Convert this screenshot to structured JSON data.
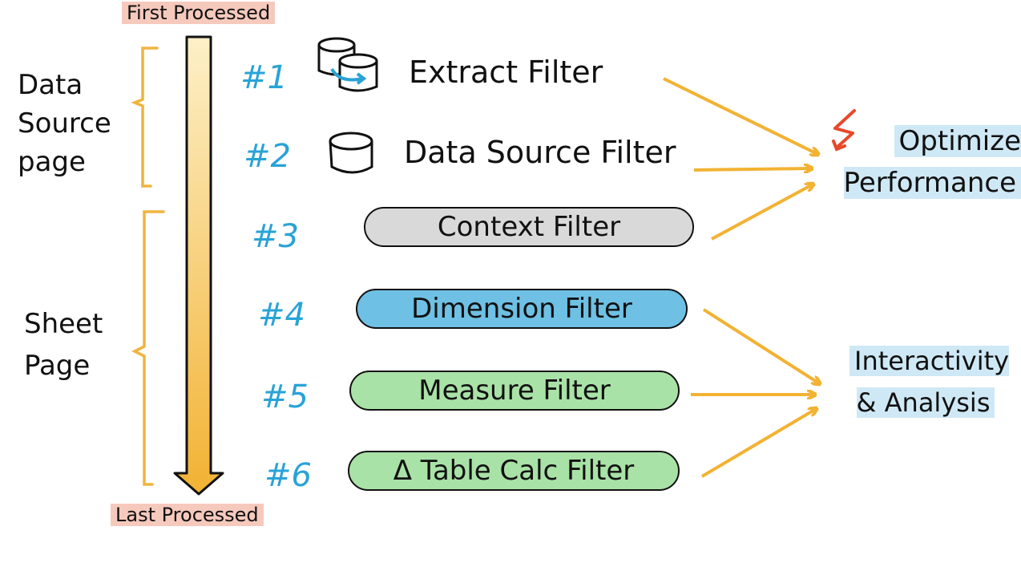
{
  "timeline": {
    "top_label": "First Processed",
    "bottom_label": "Last Processed"
  },
  "groups": {
    "data_source_page": "Data Source page",
    "sheet_page": "Sheet Page"
  },
  "filters": [
    {
      "number": "#1",
      "label": "Extract Filter"
    },
    {
      "number": "#2",
      "label": "Data Source Filter"
    },
    {
      "number": "#3",
      "label": "Context Filter"
    },
    {
      "number": "#4",
      "label": "Dimension Filter"
    },
    {
      "number": "#5",
      "label": "Measure Filter"
    },
    {
      "number": "#6",
      "label": "Δ Table Calc Filter"
    }
  ],
  "outcomes": {
    "optimize": "Optimize Performance",
    "interactivity": "Interactivity & Analysis"
  },
  "colors": {
    "arrow_orange": "#f2b233",
    "number_blue": "#29a3d6",
    "context_gray": "#d9d9d9",
    "dimension_blue": "#6ec0e4",
    "measure_green": "#a9e2a6",
    "highlight_pink": "#f6c9bd",
    "highlight_blue": "#cfe8f5",
    "bolt_red": "#e8482a"
  }
}
